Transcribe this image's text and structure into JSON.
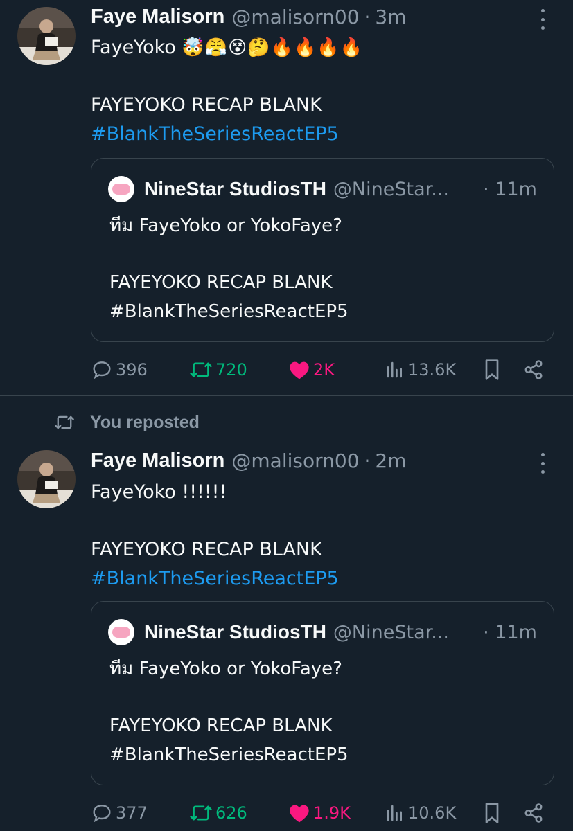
{
  "tweets": [
    {
      "repost_label": "",
      "author": {
        "name": "Faye Malisorn",
        "handle": "@malisorn00"
      },
      "separator": "·",
      "time": "3m",
      "text_line1": "FayeYoko",
      "emojis": "🤯😤😵🤔🔥🔥🔥🔥",
      "text_line2": "FAYEYOKO RECAP BLANK",
      "hashtag": "#BlankTheSeriesReactEP5",
      "quote": {
        "name": "NineStar StudiosTH",
        "handle": "@NineStar...",
        "separator": "·",
        "time": "11m",
        "line1": "ทีม FayeYoko or YokoFaye?",
        "line2": "FAYEYOKO RECAP BLANK",
        "line3": "#BlankTheSeriesReactEP5"
      },
      "stats": {
        "replies": "396",
        "reposts": "720",
        "likes": "2K",
        "views": "13.6K"
      }
    },
    {
      "repost_label": "You reposted",
      "author": {
        "name": "Faye Malisorn",
        "handle": "@malisorn00"
      },
      "separator": "·",
      "time": "2m",
      "text_line1": "FayeYoko !!!!!!",
      "emojis": "",
      "text_line2": "FAYEYOKO RECAP BLANK",
      "hashtag": "#BlankTheSeriesReactEP5",
      "quote": {
        "name": "NineStar StudiosTH",
        "handle": "@NineStar...",
        "separator": "·",
        "time": "11m",
        "line1": "ทีม FayeYoko or YokoFaye?",
        "line2": "FAYEYOKO RECAP BLANK",
        "line3": "#BlankTheSeriesReactEP5"
      },
      "stats": {
        "replies": "377",
        "reposts": "626",
        "likes": "1.9K",
        "views": "10.6K"
      }
    }
  ],
  "icons": {
    "reply": "speech-bubble-icon",
    "repost": "repost-arrows-icon",
    "like": "heart-filled-icon",
    "views": "bar-chart-icon",
    "bookmark": "bookmark-icon",
    "share": "share-icon",
    "more": "more-vertical-icon"
  },
  "colors": {
    "background": "#15202b",
    "text": "#f7f9f9",
    "muted": "#8b98a5",
    "link": "#1d9bf0",
    "repost_active": "#00ba7c",
    "like_active": "#f91880",
    "border": "#38444d"
  }
}
